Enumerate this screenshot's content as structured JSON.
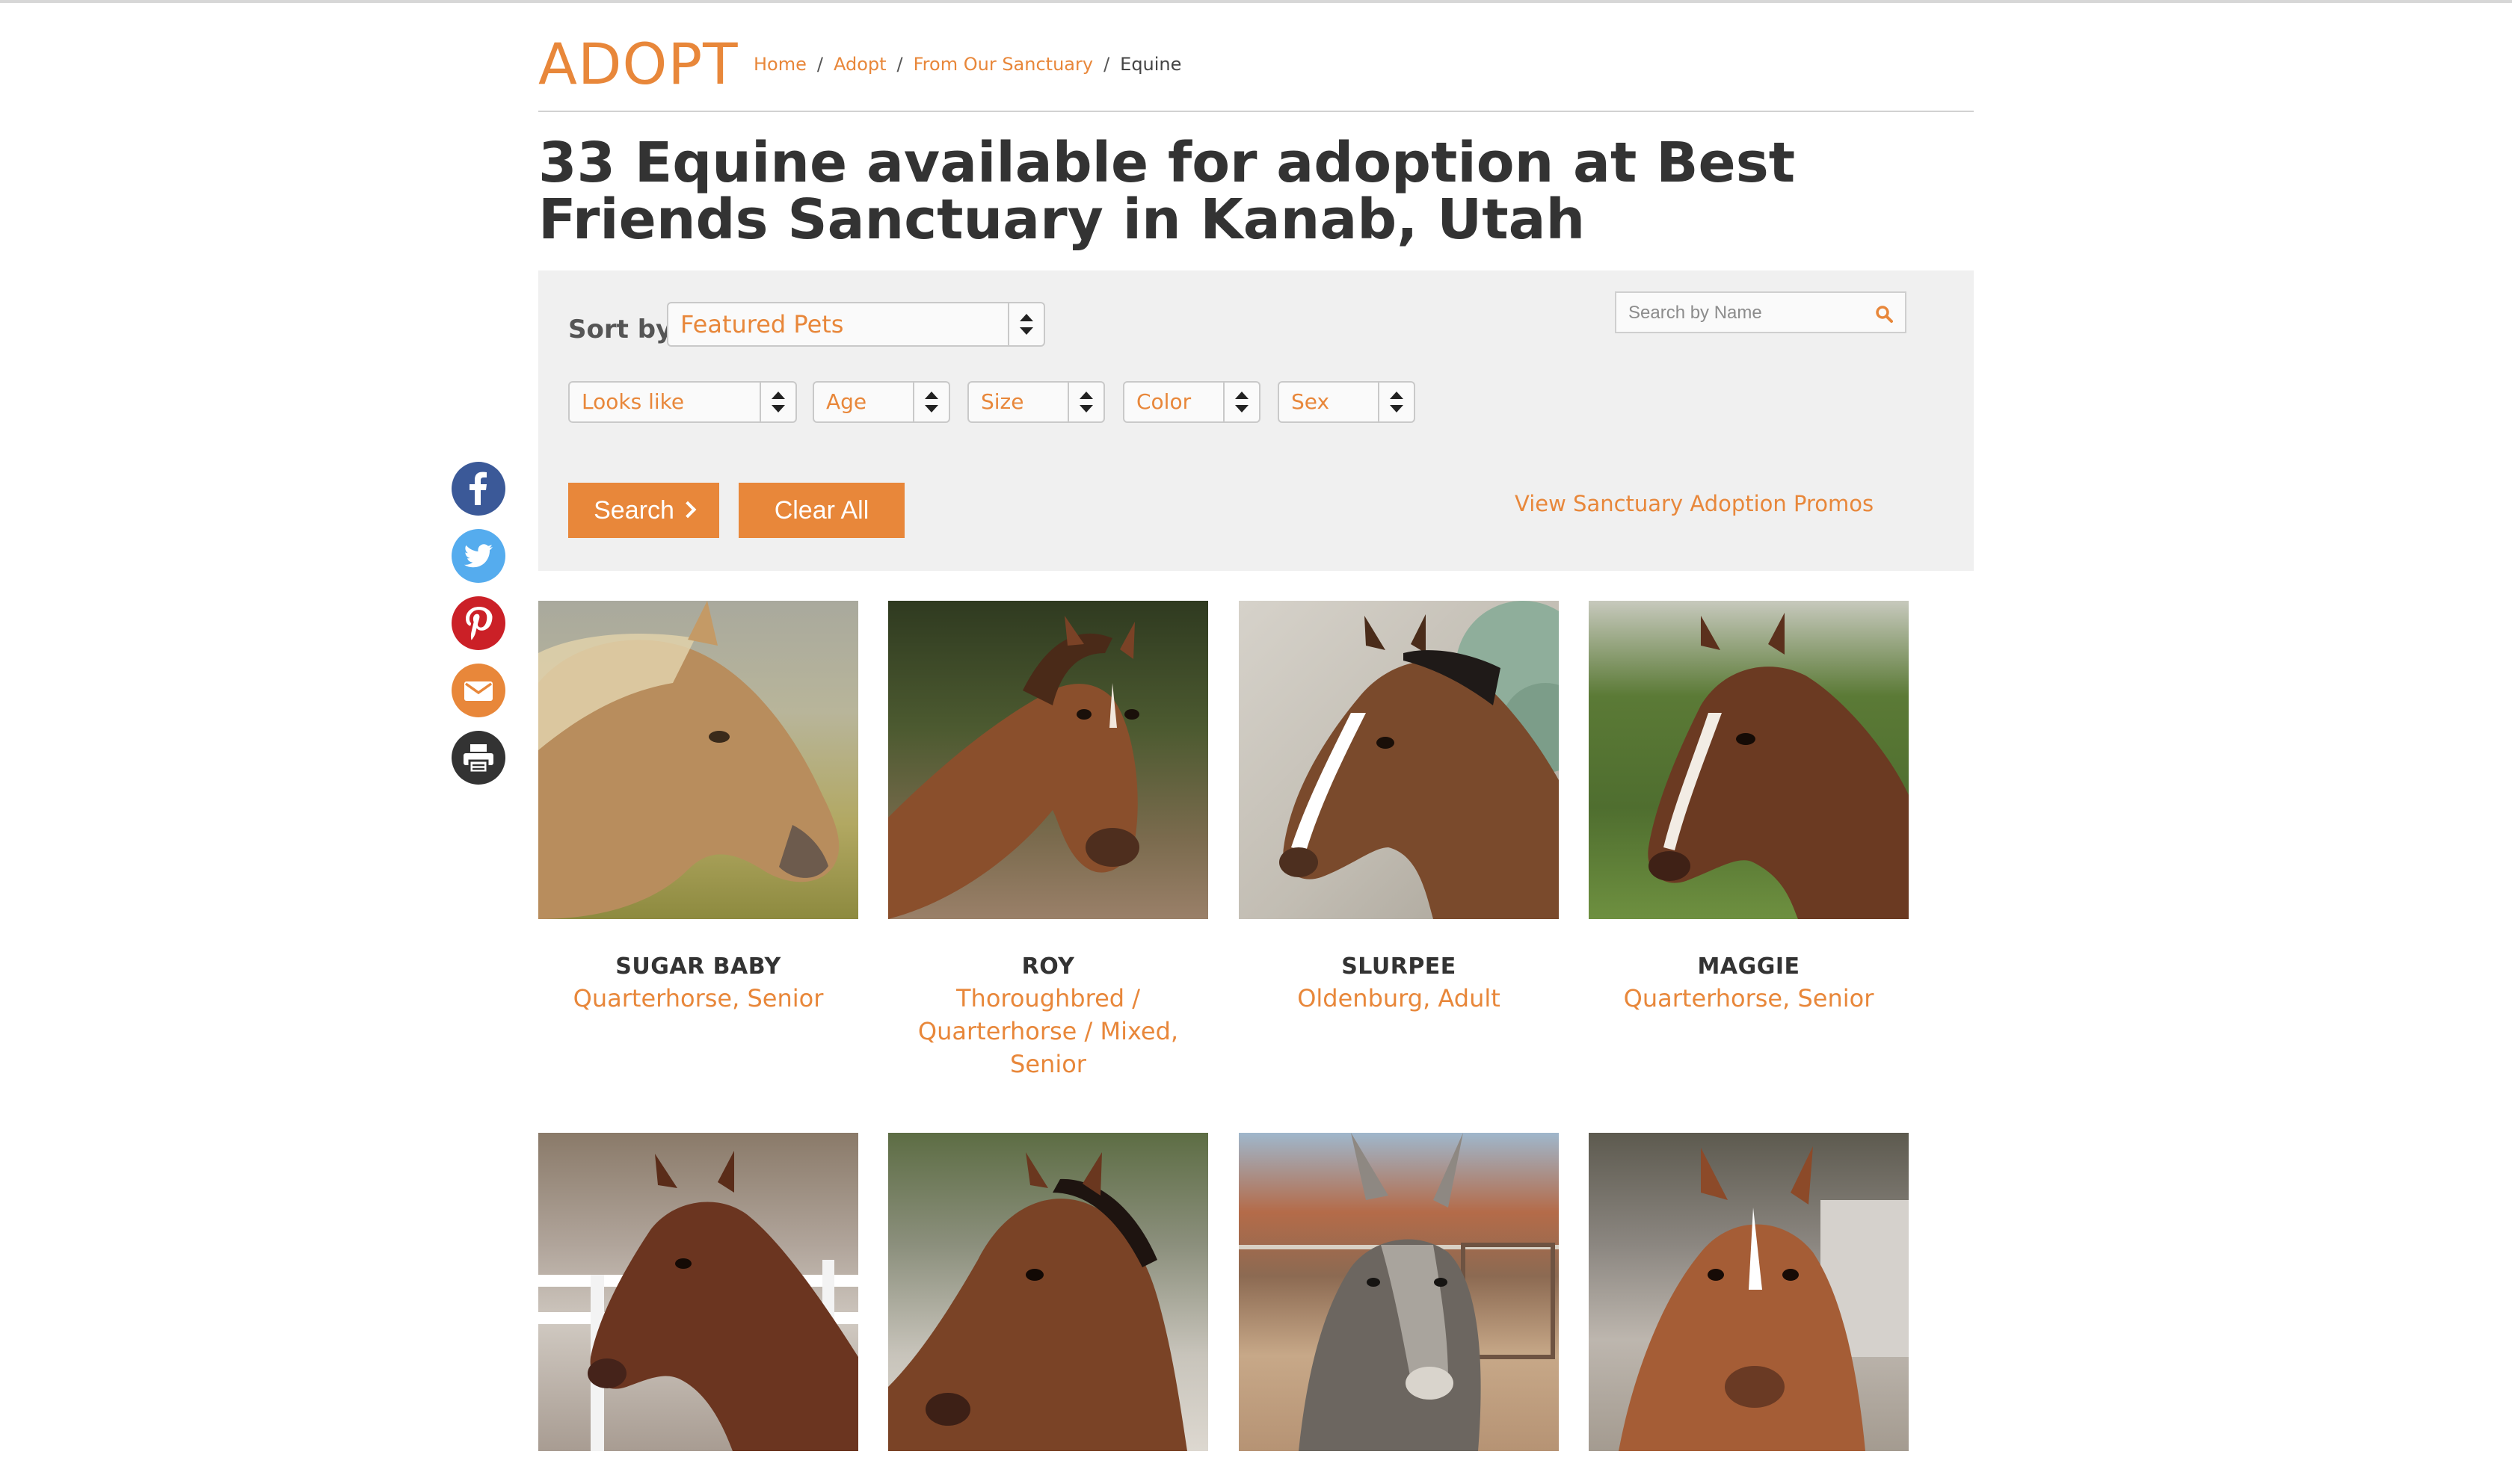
{
  "header": {
    "section_title": "ADOPT",
    "breadcrumbs": [
      {
        "label": "Home"
      },
      {
        "label": "Adopt"
      },
      {
        "label": "From Our Sanctuary"
      },
      {
        "label": "Equine"
      }
    ],
    "breadcrumb_separator": "/"
  },
  "page_title": "33 Equine available for adoption at Best Friends Sanctuary in Kanab, Utah",
  "filters": {
    "sort_label": "Sort by",
    "sort_value": "Featured Pets",
    "search_placeholder": "Search by Name",
    "looks_like": "Looks like",
    "age": "Age",
    "size": "Size",
    "color": "Color",
    "sex": "Sex",
    "search_button": "Search",
    "clear_button": "Clear All",
    "promos_link": "View Sanctuary Adoption Promos"
  },
  "social": [
    "facebook-icon",
    "twitter-icon",
    "pinterest-icon",
    "email-icon",
    "print-icon"
  ],
  "colors": {
    "accent": "#e8873a",
    "facebook": "#3b5998",
    "twitter": "#55acee",
    "pinterest": "#cb2027",
    "email": "#e8873a",
    "print": "#333333"
  },
  "pets": [
    {
      "name": "SUGAR BABY",
      "desc": "Quarterhorse, Senior"
    },
    {
      "name": "ROY",
      "desc": "Thoroughbred / Quarterhorse / Mixed, Senior"
    },
    {
      "name": "SLURPEE",
      "desc": "Oldenburg, Adult"
    },
    {
      "name": "MAGGIE",
      "desc": "Quarterhorse, Senior"
    },
    {
      "name": "",
      "desc": ""
    },
    {
      "name": "",
      "desc": ""
    },
    {
      "name": "",
      "desc": ""
    },
    {
      "name": "",
      "desc": ""
    }
  ]
}
